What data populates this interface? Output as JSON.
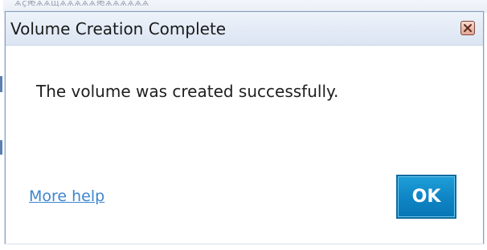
{
  "background": {
    "window_text": "ѧҫԙѧѧщѧѧѧѧѧԙѧѧѧѧѧѧ"
  },
  "dialog": {
    "title": "Volume Creation Complete",
    "message": "The volume was created successfully.",
    "more_help_link": "More help",
    "ok_label": "OK",
    "close_icon": "close-x-icon"
  },
  "colors": {
    "title_bar": "#e3ebf6",
    "link": "#3d86d1",
    "ok_button": "#0f86c6",
    "close_button": "#e3a692"
  }
}
